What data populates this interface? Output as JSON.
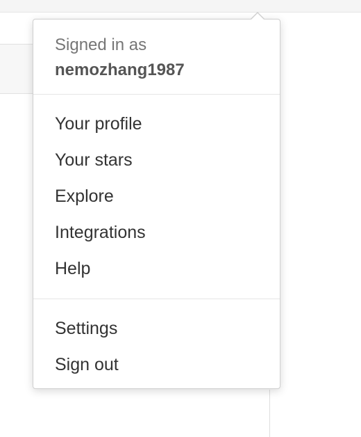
{
  "user_menu": {
    "signed_in_label": "Signed in as",
    "username": "nemozhang1987",
    "main_items": [
      {
        "label": "Your profile"
      },
      {
        "label": "Your stars"
      },
      {
        "label": "Explore"
      },
      {
        "label": "Integrations"
      },
      {
        "label": "Help"
      }
    ],
    "account_items": [
      {
        "label": "Settings"
      },
      {
        "label": "Sign out"
      }
    ]
  },
  "colors": {
    "menu_text": "#333333",
    "muted_text": "#767676",
    "border": "#cfcfcf",
    "divider": "#e5e5e5"
  }
}
